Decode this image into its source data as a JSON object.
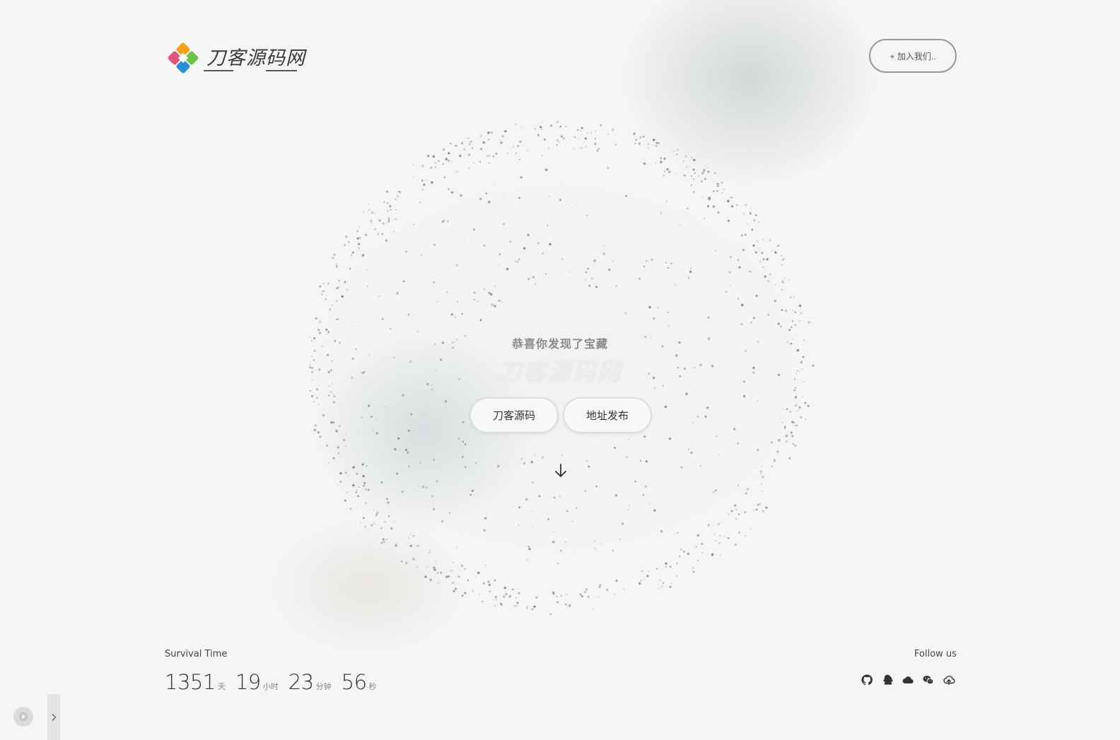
{
  "header": {
    "logo_text": "刀客源码网",
    "join_label": "+ 加入我们.."
  },
  "hero": {
    "subtitle": "恭喜你发现了宝藏",
    "title": "刀客源码网",
    "buttons": [
      {
        "label": "刀客源码"
      },
      {
        "label": "地址发布"
      }
    ]
  },
  "survival": {
    "label": "Survival Time",
    "days": "1351",
    "days_unit": "天",
    "hours": "19",
    "hours_unit": "小时",
    "minutes": "23",
    "minutes_unit": "分钟",
    "seconds": "56",
    "seconds_unit": "秒"
  },
  "follow": {
    "label": "Follow us",
    "icons": [
      "github-icon",
      "qq-icon",
      "cloud-icon",
      "wechat-icon",
      "cloud-upload-icon"
    ]
  },
  "colors": {
    "background": "#f4f5f4",
    "text": "#333333",
    "muted": "#8a8a8a",
    "logo_orange": "#f2a21b",
    "logo_green": "#6cc24a",
    "logo_blue": "#2a8fd6",
    "logo_pink": "#e0557a"
  }
}
